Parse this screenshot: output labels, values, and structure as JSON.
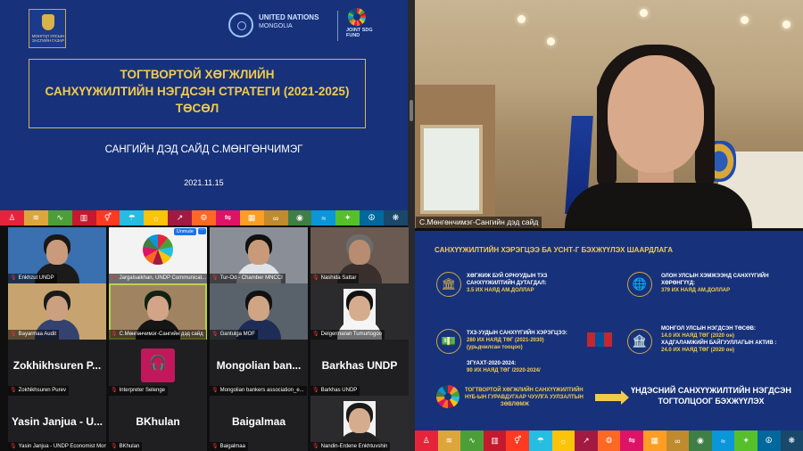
{
  "slide_left": {
    "logo_caption": "МОНГОЛ УЛСЫН ЗАСГИЙН ГАЗАР",
    "un_org": "UNITED NATIONS",
    "un_country": "MONGOLIA",
    "jsf": "JOINT SDG FUND",
    "title_lines": [
      "ТОГТВОРТОЙ ХӨГЖЛИЙН",
      "САНХҮҮЖИЛТИЙН НЭГДСЭН  СТРАТЕГИ (2021-2025)",
      "ТӨСӨЛ"
    ],
    "presenter": "САНГИЙН ДЭД САЙД С.МӨНГӨНЧИМЭГ",
    "date": "2021.11.15"
  },
  "sdg_colors": [
    "#e5243b",
    "#dda63a",
    "#4c9f38",
    "#c5192d",
    "#ff3a21",
    "#26bde2",
    "#fcc30b",
    "#a21942",
    "#fd6925",
    "#dd1367",
    "#fd9d24",
    "#bf8b2e",
    "#3f7e44",
    "#0a97d9",
    "#56c02b",
    "#00689d",
    "#19486a"
  ],
  "sdg_glyphs": [
    "♙",
    "≋",
    "∿",
    "▥",
    "⚥",
    "☂",
    "☼",
    "↗",
    "⚙",
    "⇋",
    "▦",
    "∞",
    "◉",
    "≈",
    "✦",
    "☮",
    "❋"
  ],
  "speaker": {
    "name": "С.Мөнгөнчимэг-Сангийн дэд сайд"
  },
  "tiles": [
    {
      "label": "Enkhzul UNDP",
      "big": ""
    },
    {
      "label": "Jargalsaikhan, UNDP Communicat...",
      "big": "",
      "unmute": "Unmute"
    },
    {
      "label": "Tur-Od - Chamber MNCCI",
      "big": ""
    },
    {
      "label": "Nashida Sattar",
      "big": ""
    },
    {
      "label": "Bayarmaa Audit",
      "big": ""
    },
    {
      "label": "С.Мөнгөнчимэг-Сангийн дэд сайд",
      "big": ""
    },
    {
      "label": "Gantulga MOF",
      "big": ""
    },
    {
      "label": "Delgermaran Tumurtogoo",
      "big": ""
    },
    {
      "label": "Zokhikhsuren Purev",
      "big": "Zokhikhsuren P..."
    },
    {
      "label": "Interpreter Selenge",
      "big": ""
    },
    {
      "label": "Mongolian bankers association_e...",
      "big": "Mongolian ban..."
    },
    {
      "label": "Barkhas UNDP",
      "big": "Barkhas UNDP"
    },
    {
      "label": "Yasin Janjua - UNDP Economist Mon...",
      "big": "Yasin Janjua - U..."
    },
    {
      "label": "BKhulan",
      "big": "BKhulan"
    },
    {
      "label": "Baigalmaa",
      "big": "Baigalmaa"
    },
    {
      "label": "Nandin-Erdene Enkhtuvshin",
      "big": ""
    }
  ],
  "slide_right": {
    "title": "САНХҮҮЖИЛТИЙН ХЭРЭГЦЭЭ БА УСНТ-Г БЭХЖҮҮЛЭХ ШААРДЛАГА",
    "b1": [
      "ХӨГЖИЖ БУЙ ОРНУУДЫН ТХЗ",
      "САНХҮҮЖИЛТИЙН ДУТАГДАЛ:",
      "3.5 ИХ НАЯД АМ.ДОЛЛАР"
    ],
    "b2": [
      "ОЛОН УЛСЫН ХЭМЖЭЭНД САНХҮҮГИЙН",
      "ХӨРӨНГҮҮД:",
      "379 ИХ НАЯД АМ.ДОЛЛАР"
    ],
    "b3": [
      "ТХЗ-УУДЫН САНХҮҮГИЙН ХЭРЭГЦЭЭ:",
      "280 ИХ НАЯД ТӨГ (2021-2030)",
      "(урьдчилсан тооцоо)"
    ],
    "b3b": [
      "ЗГҮАХТ-2020-2024:",
      "90 ИХ НАЯД ТӨГ /2020-2024/"
    ],
    "b4": [
      "МОНГОЛ УЛСЫН НЭГДСЭН ТӨСӨВ:",
      "14.0 ИХ НАЯД ТӨГ (2020 он)",
      "ХАДГАЛАМЖИЙН БАЙГУУЛЛАГЫН АКТИВ :",
      "24.0 ИХ НАЯД ТӨГ (2020 он)"
    ],
    "proposal": [
      "ТОГТВОРТОЙ ХӨГЖЛИЙН САНХҮҮЖИЛТИЙН",
      "НҮБ-ЫН ГУРАВДУГААР ЧУУЛГА УУЛЗАЛТЫН",
      "ЗӨВЛӨМЖ"
    ],
    "result": [
      "ҮНДЭСНИЙ САНХҮҮЖИЛТИЙН НЭГДСЭН",
      "ТОГТОЛЦООГ БЭХЖҮҮЛЭХ"
    ],
    "flag_colors": [
      "#c4272f",
      "#015197",
      "#c4272f"
    ]
  }
}
